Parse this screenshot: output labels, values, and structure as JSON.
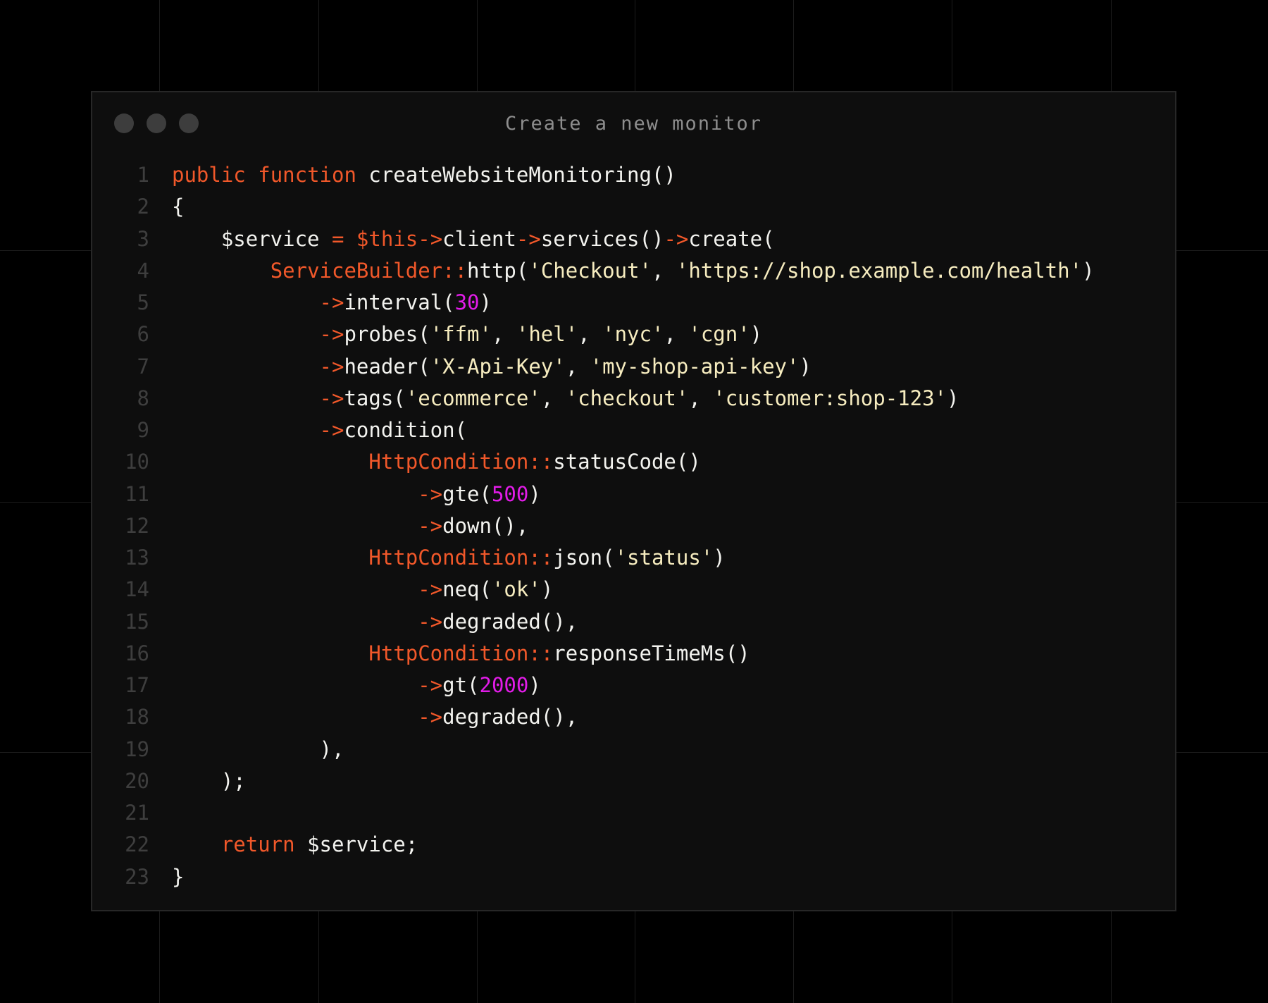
{
  "window": {
    "title": "Create a new monitor",
    "dots": [
      "window-control",
      "window-control",
      "window-control"
    ]
  },
  "colors": {
    "background": "#000000",
    "window_bg": "#0e0e0e",
    "keyword": "#f1582a",
    "string": "#f6ecbf",
    "number": "#e21ce8",
    "text": "#f3f3ef",
    "line_number": "#3e3e3e"
  },
  "code": {
    "lines": [
      {
        "n": "1",
        "tokens": [
          [
            "kw",
            "public"
          ],
          [
            "plain",
            " "
          ],
          [
            "kw",
            "function"
          ],
          [
            "plain",
            " createWebsiteMonitoring()"
          ]
        ]
      },
      {
        "n": "2",
        "tokens": [
          [
            "plain",
            "{"
          ]
        ]
      },
      {
        "n": "3",
        "tokens": [
          [
            "plain",
            "    $service "
          ],
          [
            "op",
            "="
          ],
          [
            "plain",
            " "
          ],
          [
            "var",
            "$this"
          ],
          [
            "op",
            "->"
          ],
          [
            "plain",
            "client"
          ],
          [
            "op",
            "->"
          ],
          [
            "plain",
            "services()"
          ],
          [
            "op",
            "->"
          ],
          [
            "plain",
            "create("
          ]
        ]
      },
      {
        "n": "4",
        "tokens": [
          [
            "plain",
            "        "
          ],
          [
            "cls",
            "ServiceBuilder::"
          ],
          [
            "plain",
            "http("
          ],
          [
            "str",
            "'Checkout'"
          ],
          [
            "plain",
            ", "
          ],
          [
            "str",
            "'https://shop.example.com/health'"
          ],
          [
            "plain",
            ")"
          ]
        ]
      },
      {
        "n": "5",
        "tokens": [
          [
            "plain",
            "            "
          ],
          [
            "op",
            "->"
          ],
          [
            "plain",
            "interval("
          ],
          [
            "num",
            "30"
          ],
          [
            "plain",
            ")"
          ]
        ]
      },
      {
        "n": "6",
        "tokens": [
          [
            "plain",
            "            "
          ],
          [
            "op",
            "->"
          ],
          [
            "plain",
            "probes("
          ],
          [
            "str",
            "'ffm'"
          ],
          [
            "plain",
            ", "
          ],
          [
            "str",
            "'hel'"
          ],
          [
            "plain",
            ", "
          ],
          [
            "str",
            "'nyc'"
          ],
          [
            "plain",
            ", "
          ],
          [
            "str",
            "'cgn'"
          ],
          [
            "plain",
            ")"
          ]
        ]
      },
      {
        "n": "7",
        "tokens": [
          [
            "plain",
            "            "
          ],
          [
            "op",
            "->"
          ],
          [
            "plain",
            "header("
          ],
          [
            "str",
            "'X-Api-Key'"
          ],
          [
            "plain",
            ", "
          ],
          [
            "str",
            "'my-shop-api-key'"
          ],
          [
            "plain",
            ")"
          ]
        ]
      },
      {
        "n": "8",
        "tokens": [
          [
            "plain",
            "            "
          ],
          [
            "op",
            "->"
          ],
          [
            "plain",
            "tags("
          ],
          [
            "str",
            "'ecommerce'"
          ],
          [
            "plain",
            ", "
          ],
          [
            "str",
            "'checkout'"
          ],
          [
            "plain",
            ", "
          ],
          [
            "str",
            "'customer:shop-123'"
          ],
          [
            "plain",
            ")"
          ]
        ]
      },
      {
        "n": "9",
        "tokens": [
          [
            "plain",
            "            "
          ],
          [
            "op",
            "->"
          ],
          [
            "plain",
            "condition("
          ]
        ]
      },
      {
        "n": "10",
        "tokens": [
          [
            "plain",
            "                "
          ],
          [
            "cls",
            "HttpCondition::"
          ],
          [
            "plain",
            "statusCode()"
          ]
        ]
      },
      {
        "n": "11",
        "tokens": [
          [
            "plain",
            "                    "
          ],
          [
            "op",
            "->"
          ],
          [
            "plain",
            "gte("
          ],
          [
            "num",
            "500"
          ],
          [
            "plain",
            ")"
          ]
        ]
      },
      {
        "n": "12",
        "tokens": [
          [
            "plain",
            "                    "
          ],
          [
            "op",
            "->"
          ],
          [
            "plain",
            "down(),"
          ]
        ]
      },
      {
        "n": "13",
        "tokens": [
          [
            "plain",
            "                "
          ],
          [
            "cls",
            "HttpCondition::"
          ],
          [
            "plain",
            "json("
          ],
          [
            "str",
            "'status'"
          ],
          [
            "plain",
            ")"
          ]
        ]
      },
      {
        "n": "14",
        "tokens": [
          [
            "plain",
            "                    "
          ],
          [
            "op",
            "->"
          ],
          [
            "plain",
            "neq("
          ],
          [
            "str",
            "'ok'"
          ],
          [
            "plain",
            ")"
          ]
        ]
      },
      {
        "n": "15",
        "tokens": [
          [
            "plain",
            "                    "
          ],
          [
            "op",
            "->"
          ],
          [
            "plain",
            "degraded(),"
          ]
        ]
      },
      {
        "n": "16",
        "tokens": [
          [
            "plain",
            "                "
          ],
          [
            "cls",
            "HttpCondition::"
          ],
          [
            "plain",
            "responseTimeMs()"
          ]
        ]
      },
      {
        "n": "17",
        "tokens": [
          [
            "plain",
            "                    "
          ],
          [
            "op",
            "->"
          ],
          [
            "plain",
            "gt("
          ],
          [
            "num",
            "2000"
          ],
          [
            "plain",
            ")"
          ]
        ]
      },
      {
        "n": "18",
        "tokens": [
          [
            "plain",
            "                    "
          ],
          [
            "op",
            "->"
          ],
          [
            "plain",
            "degraded(),"
          ]
        ]
      },
      {
        "n": "19",
        "tokens": [
          [
            "plain",
            "            ),"
          ]
        ]
      },
      {
        "n": "20",
        "tokens": [
          [
            "plain",
            "    );"
          ]
        ]
      },
      {
        "n": "21",
        "tokens": []
      },
      {
        "n": "22",
        "tokens": [
          [
            "plain",
            "    "
          ],
          [
            "kw",
            "return"
          ],
          [
            "plain",
            " $service;"
          ]
        ]
      },
      {
        "n": "23",
        "tokens": [
          [
            "plain",
            "}"
          ]
        ]
      }
    ]
  }
}
